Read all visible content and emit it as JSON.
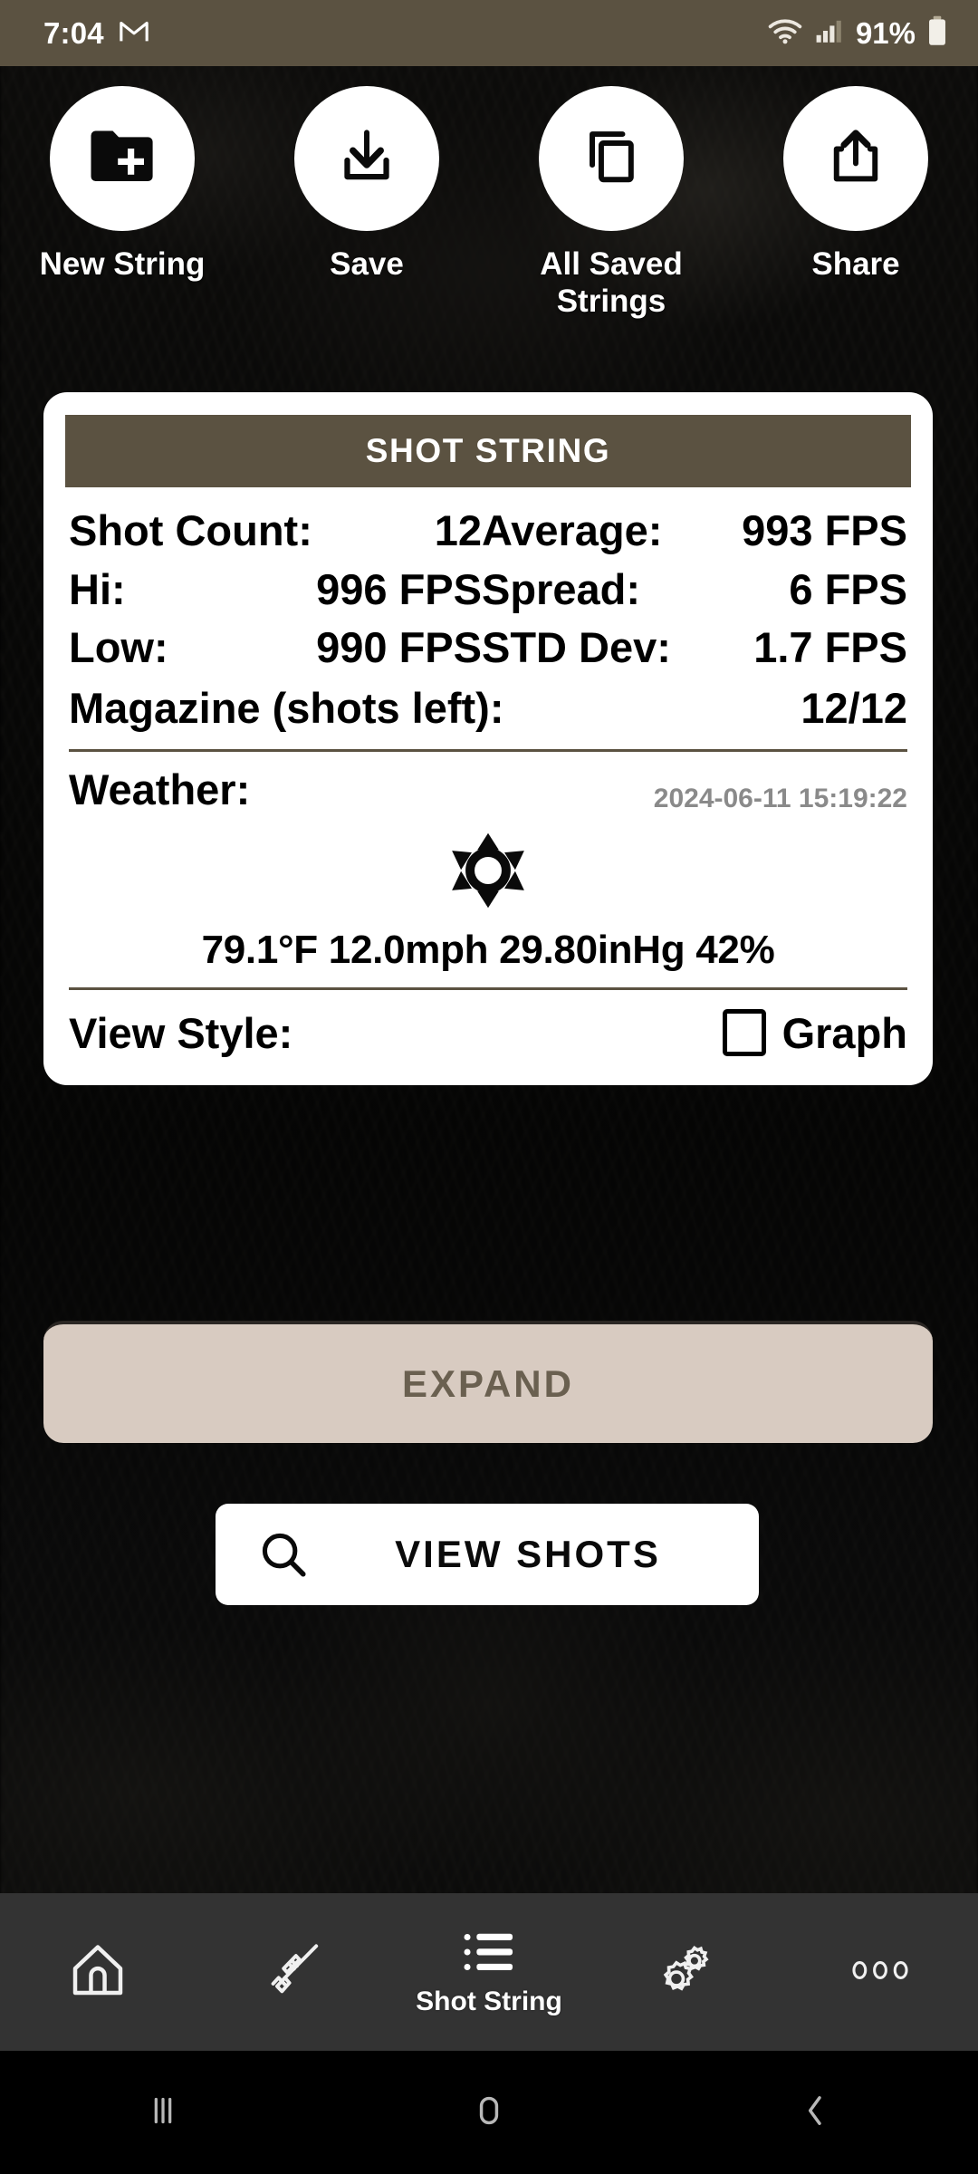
{
  "statusbar": {
    "time": "7:04",
    "mail_icon": "gmail-icon",
    "wifi_icon": "wifi-icon",
    "signal_icon": "cellular-signal-icon",
    "battery_percent": "91%",
    "battery_icon": "battery-icon",
    "background_color": "#5b5241"
  },
  "toolbar": {
    "items": [
      {
        "label": "New String",
        "icon": "folder-plus-icon"
      },
      {
        "label": "Save",
        "icon": "download-icon"
      },
      {
        "label": "All Saved Strings",
        "icon": "copy-icon"
      },
      {
        "label": "Share",
        "icon": "share-upload-icon"
      }
    ]
  },
  "card": {
    "header_title": "SHOT STRING",
    "header_color": "#5b5241",
    "stats": {
      "shot_count_label": "Shot Count:",
      "shot_count_value": "12",
      "average_label": "Average:",
      "average_value": "993 FPS",
      "hi_label": "Hi:",
      "hi_value": "996 FPS",
      "spread_label": "Spread:",
      "spread_value": "6 FPS",
      "low_label": "Low:",
      "low_value": "990 FPS",
      "std_dev_label": "STD Dev:",
      "std_dev_value": "1.7 FPS",
      "magazine_label": "Magazine (shots left):",
      "magazine_value": "12/12"
    },
    "weather": {
      "label": "Weather:",
      "timestamp": "2024-06-11 15:19:22",
      "icon": "sun-icon",
      "readings": "79.1°F 12.0mph 29.80inHg 42%",
      "temperature": "79.1°F",
      "wind_speed": "12.0mph",
      "pressure": "29.80inHg",
      "humidity": "42%"
    },
    "view_style": {
      "label": "View Style:",
      "graph_label": "Graph",
      "graph_checked": false
    }
  },
  "expand_button": {
    "label": "EXPAND",
    "background_color": "#d8cbc1",
    "text_color": "#6a6050"
  },
  "view_shots_button": {
    "label": "VIEW SHOTS",
    "icon": "search-icon"
  },
  "app_nav": {
    "items": [
      {
        "label": "",
        "icon": "home-icon",
        "active": false
      },
      {
        "label": "",
        "icon": "rifle-icon",
        "active": false
      },
      {
        "label": "Shot String",
        "icon": "list-icon",
        "active": true
      },
      {
        "label": "",
        "icon": "gears-icon",
        "active": false
      },
      {
        "label": "",
        "icon": "more-dots-icon",
        "active": false
      }
    ]
  },
  "system_nav": {
    "items": [
      {
        "icon": "recents-icon"
      },
      {
        "icon": "home-square-icon"
      },
      {
        "icon": "back-chevron-icon"
      }
    ]
  }
}
